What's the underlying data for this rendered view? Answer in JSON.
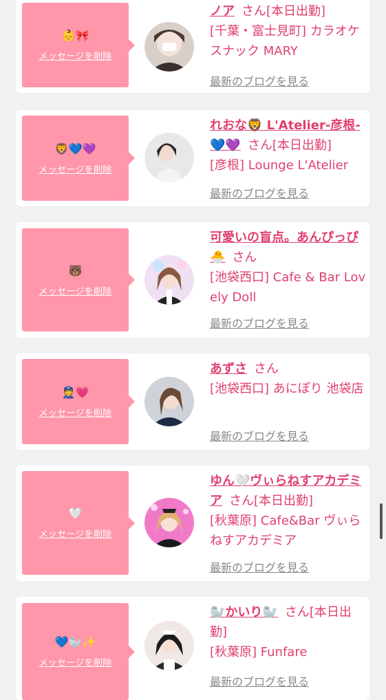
{
  "delete_label": "メッセージを削除",
  "blog_label": "最新のブログを見る",
  "colors": {
    "background": "#f1f1f1",
    "card": "#ffffff",
    "bubble": "#ff96aa",
    "name_pink": "#e0406e",
    "blog_gray": "#888888"
  },
  "cards": [
    {
      "emoji": "👶🎀",
      "name": "ノア",
      "suffix": "さん[本日出勤]",
      "shop": "[千葉・富士見町] カラオケスナック MARY"
    },
    {
      "emoji": "🦁💙💜",
      "name": "れおな🦁 L'Atelier-彦根-💙💜",
      "suffix": "さん[本日出勤]",
      "shop": "[彦根] Lounge L'Atelier"
    },
    {
      "emoji": "🐻",
      "name": "可愛いの盲点。あんぴっぴ🐣",
      "suffix": "さん",
      "shop": "[池袋西口] Cafe & Bar Lovely Doll"
    },
    {
      "emoji": "👮💗",
      "name": "あずさ",
      "suffix": "さん",
      "shop": "[池袋西口] あにぽり 池袋店"
    },
    {
      "emoji": "🤍",
      "name": "ゆん🤍ヴぃらねすアカデミア",
      "suffix": "さん[本日出勤]",
      "shop": "[秋葉原] Cafe&Bar ヴぃらねすアカデミア"
    },
    {
      "emoji": "💙🦭✨",
      "name": "🦭かいり🦭",
      "suffix": "さん[本日出勤]",
      "shop": "[秋葉原] Funfare"
    }
  ]
}
